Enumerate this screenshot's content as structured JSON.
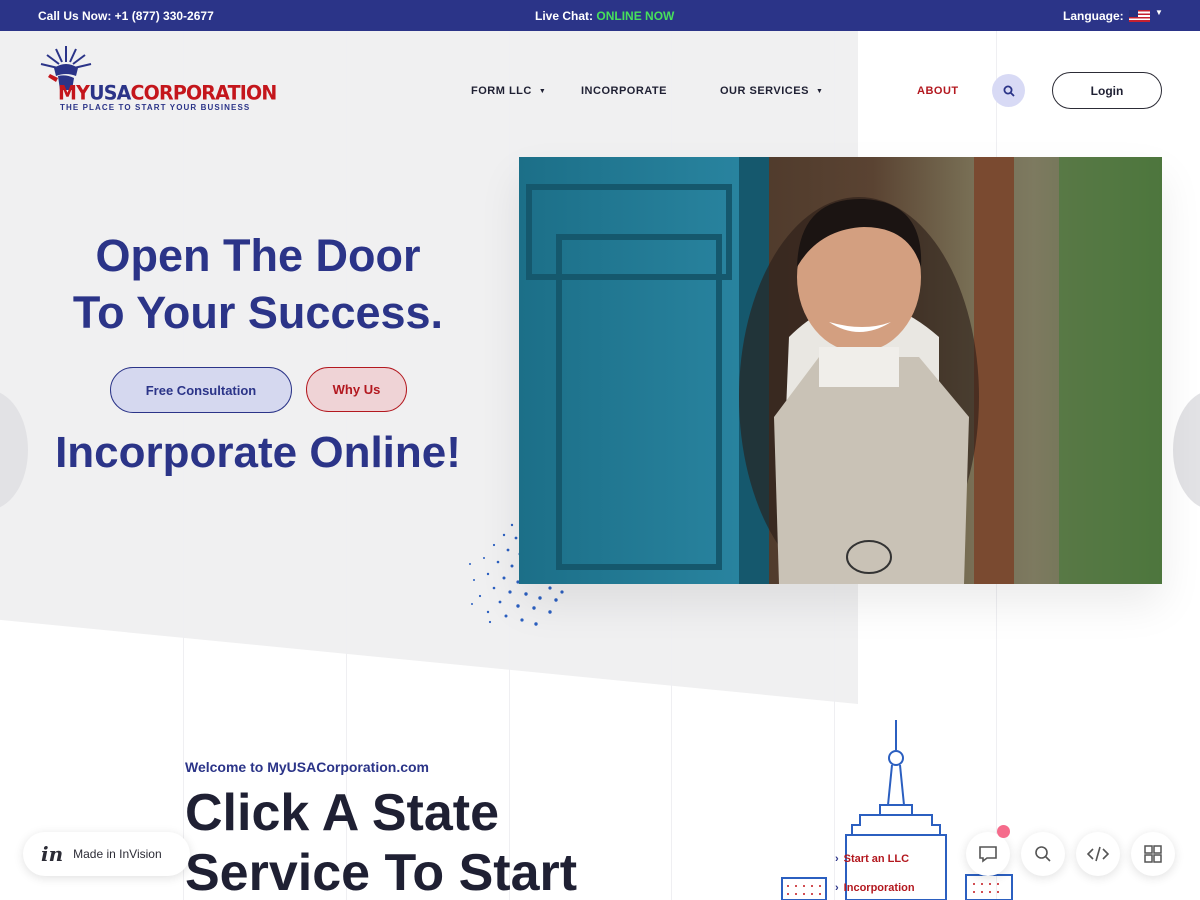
{
  "topbar": {
    "phone": "Call Us Now: +1 (877) 330-2677",
    "chat_prefix": "Live Chat:",
    "chat_status": "ONLINE NOW",
    "language_label": "Language:",
    "language_flag": "us-flag-icon"
  },
  "logo": {
    "word_my": "MY",
    "word_usa": "USA",
    "word_corp": "CORPORATION",
    "tagline": "THE PLACE TO START YOUR BUSINESS"
  },
  "nav": {
    "form_llc": "FORM LLC",
    "incorporate": "INCORPORATE",
    "our_services": "OUR SERVICES",
    "about": "ABOUT",
    "login": "Login"
  },
  "hero": {
    "title_line1": "Open The Door",
    "title_line2": "To Your Success.",
    "consult_button": "Free Consultation",
    "why_button": "Why Us",
    "subtitle": "Incorporate Online!"
  },
  "intro": {
    "welcome": "Welcome to MyUSACorporation.com",
    "heading_line1": "Click A State",
    "heading_line2": "Service To Start"
  },
  "tower_menu": {
    "item1": "Start an LLC",
    "item2": "Incorporation"
  },
  "invision": {
    "logo": "in",
    "label": "Made in InVision"
  },
  "colors": {
    "brand_blue": "#2b3488",
    "brand_red": "#b3181f",
    "online_green": "#47e05b",
    "hero_bg": "#f0f0f1"
  }
}
